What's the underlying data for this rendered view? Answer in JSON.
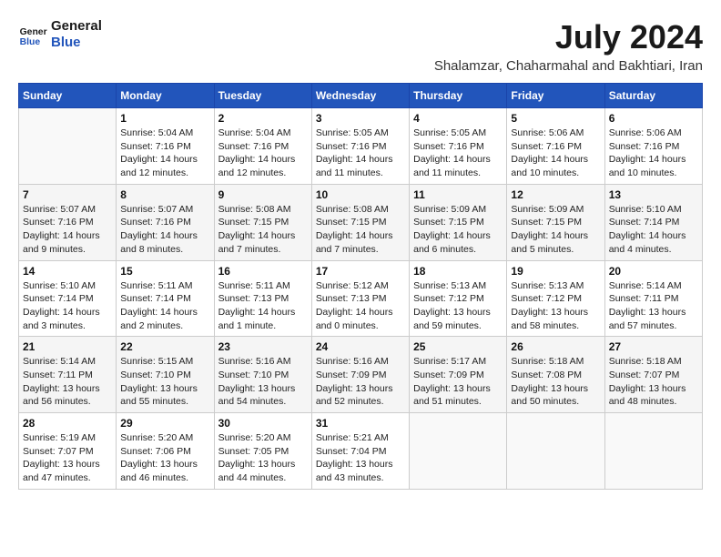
{
  "logo": {
    "line1": "General",
    "line2": "Blue"
  },
  "title": "July 2024",
  "location": "Shalamzar, Chaharmahal and Bakhtiari, Iran",
  "weekdays": [
    "Sunday",
    "Monday",
    "Tuesday",
    "Wednesday",
    "Thursday",
    "Friday",
    "Saturday"
  ],
  "weeks": [
    [
      {
        "day": "",
        "sunrise": "",
        "sunset": "",
        "daylight": ""
      },
      {
        "day": "1",
        "sunrise": "Sunrise: 5:04 AM",
        "sunset": "Sunset: 7:16 PM",
        "daylight": "Daylight: 14 hours and 12 minutes."
      },
      {
        "day": "2",
        "sunrise": "Sunrise: 5:04 AM",
        "sunset": "Sunset: 7:16 PM",
        "daylight": "Daylight: 14 hours and 12 minutes."
      },
      {
        "day": "3",
        "sunrise": "Sunrise: 5:05 AM",
        "sunset": "Sunset: 7:16 PM",
        "daylight": "Daylight: 14 hours and 11 minutes."
      },
      {
        "day": "4",
        "sunrise": "Sunrise: 5:05 AM",
        "sunset": "Sunset: 7:16 PM",
        "daylight": "Daylight: 14 hours and 11 minutes."
      },
      {
        "day": "5",
        "sunrise": "Sunrise: 5:06 AM",
        "sunset": "Sunset: 7:16 PM",
        "daylight": "Daylight: 14 hours and 10 minutes."
      },
      {
        "day": "6",
        "sunrise": "Sunrise: 5:06 AM",
        "sunset": "Sunset: 7:16 PM",
        "daylight": "Daylight: 14 hours and 10 minutes."
      }
    ],
    [
      {
        "day": "7",
        "sunrise": "Sunrise: 5:07 AM",
        "sunset": "Sunset: 7:16 PM",
        "daylight": "Daylight: 14 hours and 9 minutes."
      },
      {
        "day": "8",
        "sunrise": "Sunrise: 5:07 AM",
        "sunset": "Sunset: 7:16 PM",
        "daylight": "Daylight: 14 hours and 8 minutes."
      },
      {
        "day": "9",
        "sunrise": "Sunrise: 5:08 AM",
        "sunset": "Sunset: 7:15 PM",
        "daylight": "Daylight: 14 hours and 7 minutes."
      },
      {
        "day": "10",
        "sunrise": "Sunrise: 5:08 AM",
        "sunset": "Sunset: 7:15 PM",
        "daylight": "Daylight: 14 hours and 7 minutes."
      },
      {
        "day": "11",
        "sunrise": "Sunrise: 5:09 AM",
        "sunset": "Sunset: 7:15 PM",
        "daylight": "Daylight: 14 hours and 6 minutes."
      },
      {
        "day": "12",
        "sunrise": "Sunrise: 5:09 AM",
        "sunset": "Sunset: 7:15 PM",
        "daylight": "Daylight: 14 hours and 5 minutes."
      },
      {
        "day": "13",
        "sunrise": "Sunrise: 5:10 AM",
        "sunset": "Sunset: 7:14 PM",
        "daylight": "Daylight: 14 hours and 4 minutes."
      }
    ],
    [
      {
        "day": "14",
        "sunrise": "Sunrise: 5:10 AM",
        "sunset": "Sunset: 7:14 PM",
        "daylight": "Daylight: 14 hours and 3 minutes."
      },
      {
        "day": "15",
        "sunrise": "Sunrise: 5:11 AM",
        "sunset": "Sunset: 7:14 PM",
        "daylight": "Daylight: 14 hours and 2 minutes."
      },
      {
        "day": "16",
        "sunrise": "Sunrise: 5:11 AM",
        "sunset": "Sunset: 7:13 PM",
        "daylight": "Daylight: 14 hours and 1 minute."
      },
      {
        "day": "17",
        "sunrise": "Sunrise: 5:12 AM",
        "sunset": "Sunset: 7:13 PM",
        "daylight": "Daylight: 14 hours and 0 minutes."
      },
      {
        "day": "18",
        "sunrise": "Sunrise: 5:13 AM",
        "sunset": "Sunset: 7:12 PM",
        "daylight": "Daylight: 13 hours and 59 minutes."
      },
      {
        "day": "19",
        "sunrise": "Sunrise: 5:13 AM",
        "sunset": "Sunset: 7:12 PM",
        "daylight": "Daylight: 13 hours and 58 minutes."
      },
      {
        "day": "20",
        "sunrise": "Sunrise: 5:14 AM",
        "sunset": "Sunset: 7:11 PM",
        "daylight": "Daylight: 13 hours and 57 minutes."
      }
    ],
    [
      {
        "day": "21",
        "sunrise": "Sunrise: 5:14 AM",
        "sunset": "Sunset: 7:11 PM",
        "daylight": "Daylight: 13 hours and 56 minutes."
      },
      {
        "day": "22",
        "sunrise": "Sunrise: 5:15 AM",
        "sunset": "Sunset: 7:10 PM",
        "daylight": "Daylight: 13 hours and 55 minutes."
      },
      {
        "day": "23",
        "sunrise": "Sunrise: 5:16 AM",
        "sunset": "Sunset: 7:10 PM",
        "daylight": "Daylight: 13 hours and 54 minutes."
      },
      {
        "day": "24",
        "sunrise": "Sunrise: 5:16 AM",
        "sunset": "Sunset: 7:09 PM",
        "daylight": "Daylight: 13 hours and 52 minutes."
      },
      {
        "day": "25",
        "sunrise": "Sunrise: 5:17 AM",
        "sunset": "Sunset: 7:09 PM",
        "daylight": "Daylight: 13 hours and 51 minutes."
      },
      {
        "day": "26",
        "sunrise": "Sunrise: 5:18 AM",
        "sunset": "Sunset: 7:08 PM",
        "daylight": "Daylight: 13 hours and 50 minutes."
      },
      {
        "day": "27",
        "sunrise": "Sunrise: 5:18 AM",
        "sunset": "Sunset: 7:07 PM",
        "daylight": "Daylight: 13 hours and 48 minutes."
      }
    ],
    [
      {
        "day": "28",
        "sunrise": "Sunrise: 5:19 AM",
        "sunset": "Sunset: 7:07 PM",
        "daylight": "Daylight: 13 hours and 47 minutes."
      },
      {
        "day": "29",
        "sunrise": "Sunrise: 5:20 AM",
        "sunset": "Sunset: 7:06 PM",
        "daylight": "Daylight: 13 hours and 46 minutes."
      },
      {
        "day": "30",
        "sunrise": "Sunrise: 5:20 AM",
        "sunset": "Sunset: 7:05 PM",
        "daylight": "Daylight: 13 hours and 44 minutes."
      },
      {
        "day": "31",
        "sunrise": "Sunrise: 5:21 AM",
        "sunset": "Sunset: 7:04 PM",
        "daylight": "Daylight: 13 hours and 43 minutes."
      },
      {
        "day": "",
        "sunrise": "",
        "sunset": "",
        "daylight": ""
      },
      {
        "day": "",
        "sunrise": "",
        "sunset": "",
        "daylight": ""
      },
      {
        "day": "",
        "sunrise": "",
        "sunset": "",
        "daylight": ""
      }
    ]
  ]
}
